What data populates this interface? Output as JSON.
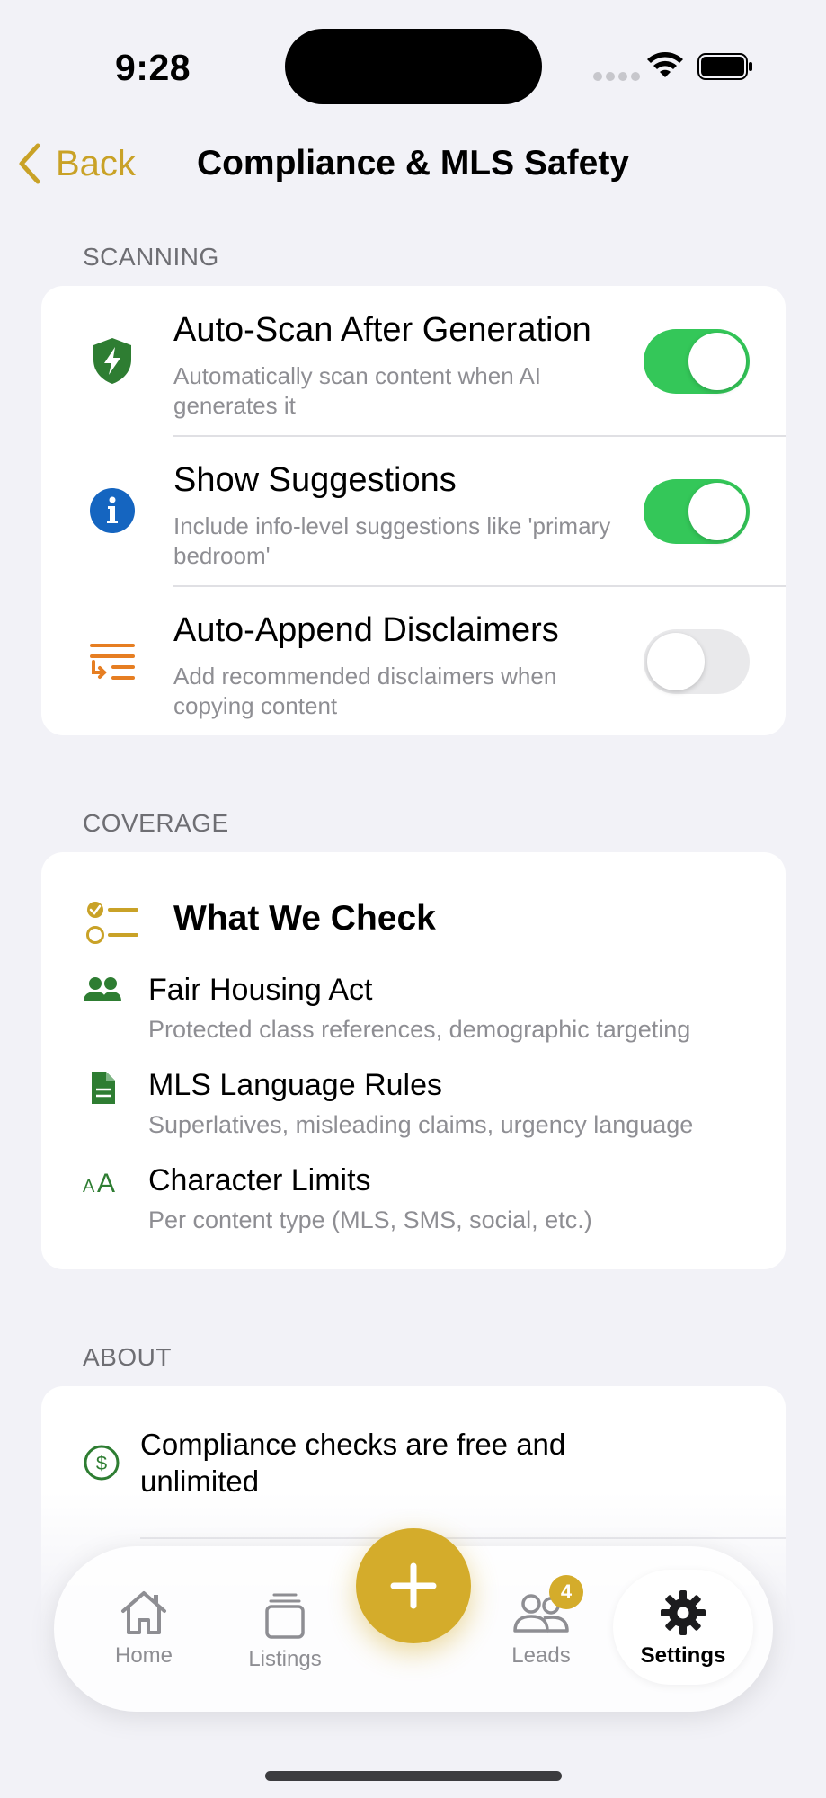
{
  "status_bar": {
    "time": "9:28"
  },
  "nav": {
    "back_label": "Back",
    "title": "Compliance & MLS Safety"
  },
  "scanning": {
    "label": "SCANNING",
    "rows": [
      {
        "title": "Auto-Scan After Generation",
        "subtitle": "Automatically scan content when AI generates it",
        "enabled": true,
        "icon": "shield-bolt-icon"
      },
      {
        "title": "Show Suggestions",
        "subtitle": "Include info-level suggestions like 'primary bedroom'",
        "enabled": true,
        "icon": "info-icon"
      },
      {
        "title": "Auto-Append Disclaimers",
        "subtitle": "Add recommended disclaimers when copying content",
        "enabled": false,
        "icon": "text-append-icon"
      }
    ]
  },
  "coverage": {
    "label": "COVERAGE",
    "heading": "What We Check",
    "items": [
      {
        "title": "Fair Housing Act",
        "subtitle": "Protected class references, demographic targeting",
        "icon": "people-icon"
      },
      {
        "title": "MLS Language Rules",
        "subtitle": "Superlatives, misleading claims, urgency language",
        "icon": "document-icon"
      },
      {
        "title": "Character Limits",
        "subtitle": "Per content type (MLS, SMS, social, etc.)",
        "icon": "text-size-icon"
      }
    ]
  },
  "about": {
    "label": "ABOUT",
    "text": "Compliance checks are free and unlimited",
    "icon": "dollar-circle-icon"
  },
  "tabbar": {
    "tabs": [
      {
        "label": "Home",
        "icon": "house-icon"
      },
      {
        "label": "Listings",
        "icon": "stack-icon"
      },
      {
        "label": "Leads",
        "icon": "people-outline-icon",
        "badge": "4"
      },
      {
        "label": "Settings",
        "icon": "gear-icon",
        "active": true
      }
    ],
    "fab_icon": "plus-icon"
  },
  "colors": {
    "accent": "#C9A227",
    "toggle_on": "#34C759",
    "icon_green": "#2E7D32",
    "icon_blue": "#1565C0",
    "icon_orange": "#E67E22"
  }
}
